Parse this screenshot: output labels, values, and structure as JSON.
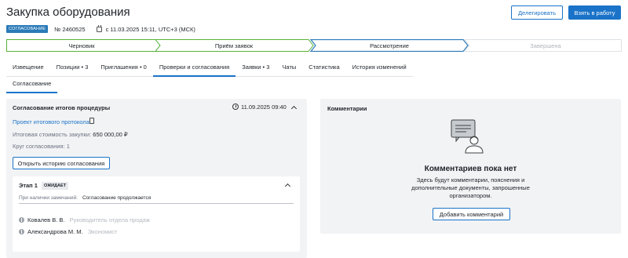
{
  "header": {
    "title": "Закупка оборудования",
    "delegate_label": "Делегировать",
    "take_label": "Взять в работу"
  },
  "meta": {
    "badge": "СОГЛАСОВАНИЕ",
    "number": "№ 2460525",
    "date": "с 11.03.2025 15:11, UTC+3 (МСК)"
  },
  "stages": [
    {
      "label": "Черновик"
    },
    {
      "label": "Приём заявок"
    },
    {
      "label": "Рассмотрение"
    },
    {
      "label": "Завершена"
    }
  ],
  "tabs": [
    {
      "label": "Извещение"
    },
    {
      "label": "Позиции • 3"
    },
    {
      "label": "Приглашения • 0"
    },
    {
      "label": "Проверки и согласования"
    },
    {
      "label": "Заявки • 3"
    },
    {
      "label": "Чаты"
    },
    {
      "label": "Статистика"
    },
    {
      "label": "История изменений"
    }
  ],
  "subtab": "Согласование",
  "approval": {
    "title": "Согласование итогов процедуры",
    "datetime": "11.09.2025 09:40",
    "protocol_link": "Проект итогового протокола",
    "cost_label": "Итоговая стоимость закупки:",
    "cost_value": "650 000,00 ₽",
    "round": "Круг согласования: 1",
    "history_button": "Открыть историю согласования",
    "stage": {
      "title": "Этап 1",
      "status": "ОЖИДАЕТ",
      "field_label": "При наличии замечаний:",
      "field_value": "Согласование продолжается",
      "approvers": [
        {
          "name": "Ковалев В. В.",
          "role": "Руководитель отдела продаж"
        },
        {
          "name": "Александрова М. М.",
          "role": "Экономист"
        }
      ]
    }
  },
  "comments": {
    "title": "Комментарии",
    "empty_title": "Комментариев пока нет",
    "empty_text_1": "Здесь будут комментарии, пояснения и",
    "empty_text_2": "дополнительные документы, запрошенные",
    "empty_text_3": "организатором.",
    "add_button": "Добавить комментарий"
  },
  "colors": {
    "accent": "#1a73c8",
    "active_stage_border": "#2a7ab8",
    "done_stage_border": "#57b23a",
    "panel_bg": "#f2f3f5"
  }
}
